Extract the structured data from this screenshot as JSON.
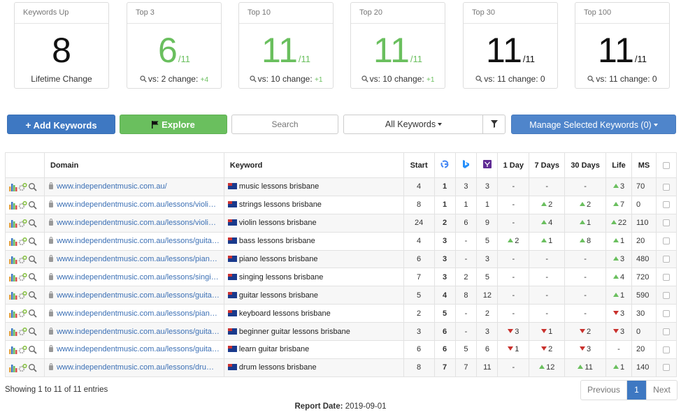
{
  "cards": [
    {
      "title": "Keywords Up",
      "value": "8",
      "of": "",
      "footer": "Lifetime Change",
      "vs": "",
      "change": ""
    },
    {
      "title": "Top 3",
      "value": "6",
      "of": "/11",
      "footer": "vs: 2 change:",
      "change": "+4"
    },
    {
      "title": "Top 10",
      "value": "11",
      "of": "/11",
      "footer": "vs: 10 change:",
      "change": "+1"
    },
    {
      "title": "Top 20",
      "value": "11",
      "of": "/11",
      "footer": "vs: 10 change:",
      "change": "+1"
    },
    {
      "title": "Top 30",
      "value": "11",
      "of": "/11",
      "footer": "vs: 11 change: 0",
      "change": ""
    },
    {
      "title": "Top 100",
      "value": "11",
      "of": "/11",
      "footer": "vs: 11 change: 0",
      "change": ""
    }
  ],
  "toolbar": {
    "add_label": "Add Keywords",
    "explore_label": "Explore",
    "search_placeholder": "Search",
    "filter_value": "All Keywords",
    "manage_label": "Manage Selected Keywords (0)"
  },
  "table": {
    "headers": {
      "domain": "Domain",
      "keyword": "Keyword",
      "start": "Start",
      "d1": "1 Day",
      "d7": "7 Days",
      "d30": "30 Days",
      "life": "Life",
      "ms": "MS"
    },
    "rows": [
      {
        "domain": "www.independentmusic.com.au/",
        "keyword": "music lessons brisbane",
        "start": "4",
        "g": "1",
        "b": "3",
        "y": "3",
        "d1": "-",
        "d1_dir": "",
        "d7": "-",
        "d7_dir": "",
        "d30": "-",
        "d30_dir": "",
        "life": "3",
        "life_dir": "up",
        "ms": "70"
      },
      {
        "domain": "www.independentmusic.com.au/lessons/violi…",
        "keyword": "strings lessons brisbane",
        "start": "8",
        "g": "1",
        "b": "1",
        "y": "1",
        "d1": "-",
        "d1_dir": "",
        "d7": "2",
        "d7_dir": "up",
        "d30": "2",
        "d30_dir": "up",
        "life": "7",
        "life_dir": "up",
        "ms": "0"
      },
      {
        "domain": "www.independentmusic.com.au/lessons/violi…",
        "keyword": "violin lessons brisbane",
        "start": "24",
        "g": "2",
        "b": "6",
        "y": "9",
        "d1": "-",
        "d1_dir": "",
        "d7": "4",
        "d7_dir": "up",
        "d30": "1",
        "d30_dir": "up",
        "life": "22",
        "life_dir": "up",
        "ms": "110"
      },
      {
        "domain": "www.independentmusic.com.au/lessons/guita…",
        "keyword": "bass lessons brisbane",
        "start": "4",
        "g": "3",
        "b": "-",
        "y": "5",
        "d1": "2",
        "d1_dir": "up",
        "d7": "1",
        "d7_dir": "up",
        "d30": "8",
        "d30_dir": "up",
        "life": "1",
        "life_dir": "up",
        "ms": "20"
      },
      {
        "domain": "www.independentmusic.com.au/lessons/pian…",
        "keyword": "piano lessons brisbane",
        "start": "6",
        "g": "3",
        "b": "-",
        "y": "3",
        "d1": "-",
        "d1_dir": "",
        "d7": "-",
        "d7_dir": "",
        "d30": "-",
        "d30_dir": "",
        "life": "3",
        "life_dir": "up",
        "ms": "480"
      },
      {
        "domain": "www.independentmusic.com.au/lessons/singi…",
        "keyword": "singing lessons brisbane",
        "start": "7",
        "g": "3",
        "b": "2",
        "y": "5",
        "d1": "-",
        "d1_dir": "",
        "d7": "-",
        "d7_dir": "",
        "d30": "-",
        "d30_dir": "",
        "life": "4",
        "life_dir": "up",
        "ms": "720"
      },
      {
        "domain": "www.independentmusic.com.au/lessons/guita…",
        "keyword": "guitar lessons brisbane",
        "start": "5",
        "g": "4",
        "b": "8",
        "y": "12",
        "d1": "-",
        "d1_dir": "",
        "d7": "-",
        "d7_dir": "",
        "d30": "-",
        "d30_dir": "",
        "life": "1",
        "life_dir": "up",
        "ms": "590"
      },
      {
        "domain": "www.independentmusic.com.au/lessons/pian…",
        "keyword": "keyboard lessons brisbane",
        "start": "2",
        "g": "5",
        "b": "-",
        "y": "2",
        "d1": "-",
        "d1_dir": "",
        "d7": "-",
        "d7_dir": "",
        "d30": "-",
        "d30_dir": "",
        "life": "3",
        "life_dir": "down",
        "ms": "30"
      },
      {
        "domain": "www.independentmusic.com.au/lessons/guita…",
        "keyword": "beginner guitar lessons brisbane",
        "start": "3",
        "g": "6",
        "b": "-",
        "y": "3",
        "d1": "3",
        "d1_dir": "down",
        "d7": "1",
        "d7_dir": "down",
        "d30": "2",
        "d30_dir": "down",
        "life": "3",
        "life_dir": "down",
        "ms": "0"
      },
      {
        "domain": "www.independentmusic.com.au/lessons/guita…",
        "keyword": "learn guitar brisbane",
        "start": "6",
        "g": "6",
        "b": "5",
        "y": "6",
        "d1": "1",
        "d1_dir": "down",
        "d7": "2",
        "d7_dir": "down",
        "d30": "3",
        "d30_dir": "down",
        "life": "-",
        "life_dir": "",
        "ms": "20"
      },
      {
        "domain": "www.independentmusic.com.au/lessons/dru…",
        "keyword": "drum lessons brisbane",
        "start": "8",
        "g": "7",
        "b": "7",
        "y": "11",
        "d1": "-",
        "d1_dir": "",
        "d7": "12",
        "d7_dir": "up",
        "d30": "11",
        "d30_dir": "up",
        "life": "1",
        "life_dir": "up",
        "ms": "140"
      }
    ]
  },
  "footer": {
    "entries": "Showing 1 to 11 of 11 entries",
    "prev": "Previous",
    "page": "1",
    "next": "Next",
    "report_label": "Report Date:",
    "report_date": "2019-09-01"
  },
  "colors": {
    "green": "#6abf5e",
    "blue": "#3e78c2",
    "red": "#c9302c"
  }
}
